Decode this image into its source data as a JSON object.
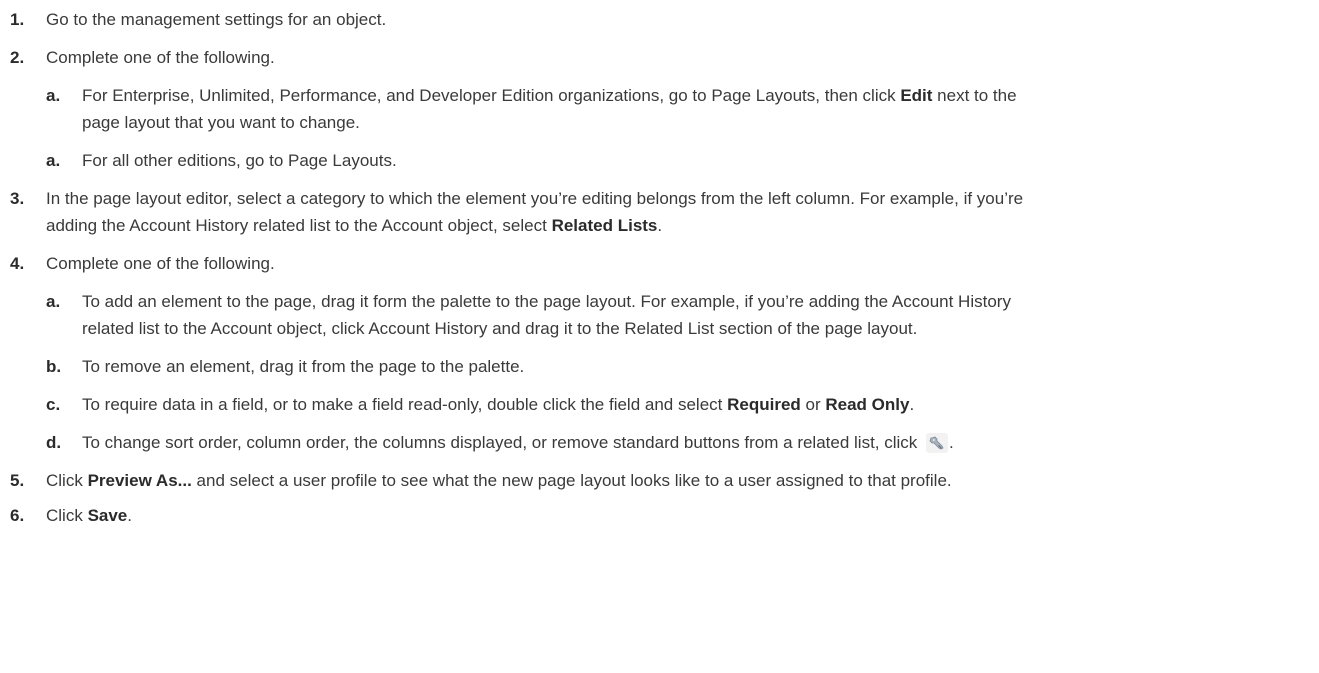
{
  "steps": [
    {
      "num": "1.",
      "text": "Go to the management settings for an object."
    },
    {
      "num": "2.",
      "text": "Complete one of the following.",
      "subs": [
        {
          "num": "a.",
          "pre": "For Enterprise, Unlimited, Performance, and Developer Edition organizations, go to Page Layouts, then click ",
          "bold": "Edit",
          "mid": " next to the",
          "line2": "page layout that you want to change."
        },
        {
          "num": "a.",
          "text": "For all other editions, go to Page Layouts."
        }
      ]
    },
    {
      "num": "3.",
      "line1": "In the page layout editor, select a category to which the element you’re editing belongs from the left column. For example, if you’re",
      "pre": "adding the Account History related list to the Account object, select ",
      "bold": "Related Lists",
      "post": "."
    },
    {
      "num": "4.",
      "text": "Complete one of the following.",
      "subs": [
        {
          "num": "a.",
          "line1": "To add an element to the page, drag it form the palette to the page layout. For example, if you’re adding the Account History",
          "line2": "related list to the Account object, click Account History and drag it to the Related List section of the page layout."
        },
        {
          "num": "b.",
          "text": "To remove an element, drag it from the page to the palette."
        },
        {
          "num": "c.",
          "pre": "To require data in a field, or to make a field read-only, double click the field and select ",
          "bold1": "Required",
          "mid": " or ",
          "bold2": "Read Only",
          "post": "."
        },
        {
          "num": "d.",
          "pre": "To change sort order, column order, the columns displayed, or remove standard buttons from a related list, click ",
          "icon": "wrench-icon",
          "post": "."
        }
      ]
    },
    {
      "num": "5.",
      "pre": "Click ",
      "bold": "Preview As...",
      "post": " and select a user profile to see what the new page layout looks like to a user assigned to that profile."
    },
    {
      "num": "6.",
      "pre": "Click ",
      "bold": "Save",
      "post": "."
    }
  ]
}
